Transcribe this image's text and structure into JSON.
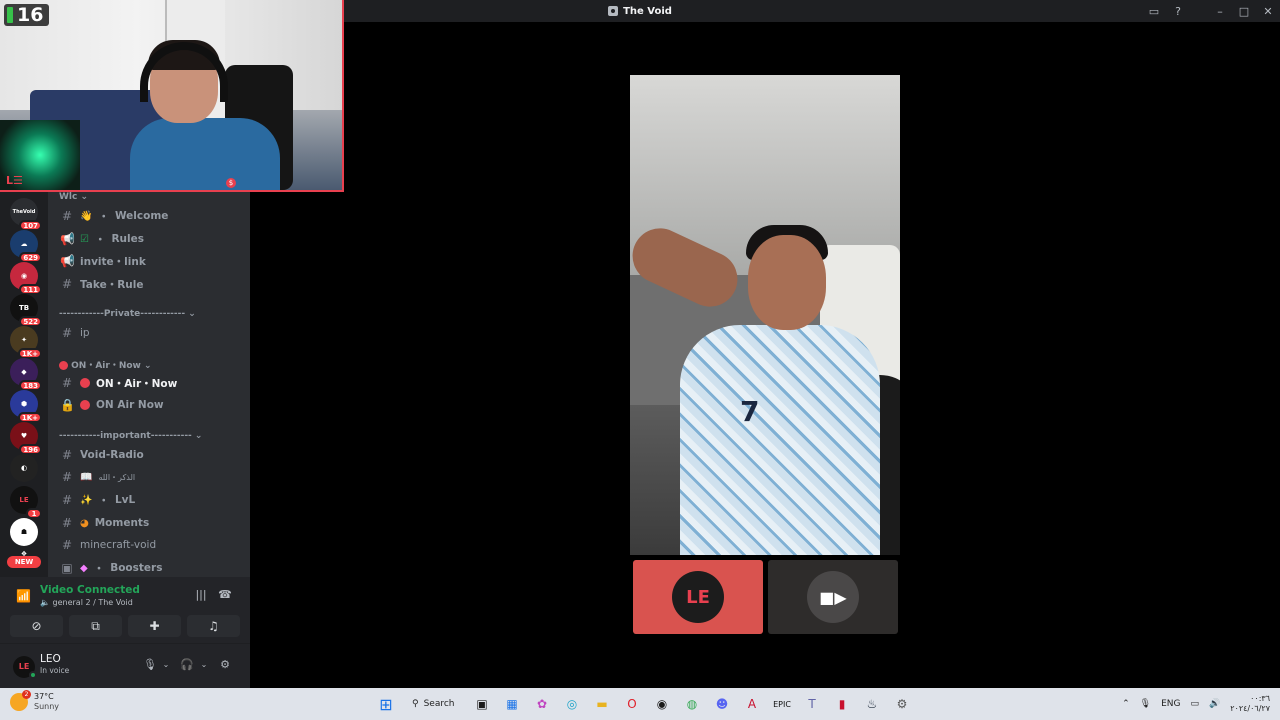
{
  "window": {
    "title": "The Void",
    "controls": [
      "inbox-icon",
      "help-icon",
      "minimize-icon",
      "maximize-icon",
      "close-icon"
    ]
  },
  "webcam": {
    "counter": "16",
    "accent": "#e8404f"
  },
  "rail": {
    "servers": [
      {
        "abbr": "TheVoid",
        "badge": "107"
      },
      {
        "abbr": "☁",
        "badge": "629"
      },
      {
        "abbr": "◉",
        "badge": "111"
      },
      {
        "abbr": "TB",
        "badge": "522"
      },
      {
        "abbr": "✦",
        "badge": "1K+"
      },
      {
        "abbr": "◆",
        "badge": "183"
      },
      {
        "abbr": "⬢",
        "badge": "1K+"
      },
      {
        "abbr": "♥",
        "badge": "196"
      },
      {
        "abbr": "◐",
        "badge": ""
      },
      {
        "abbr": "LE",
        "badge": "1"
      },
      {
        "abbr": "☗",
        "badge": ""
      },
      {
        "abbr": "❖",
        "badge": ""
      }
    ],
    "new_label": "NEW"
  },
  "channels": {
    "top_category": "Wlc",
    "welcome": "Welcome",
    "rules": "Rules",
    "invite": "invite・link",
    "take_rule": "Take・Rule",
    "private_category": "------------Private------------",
    "ip": "ip",
    "on_air_category": "ON・Air・Now",
    "on_air_now": "ON・Air・Now",
    "on_air_locked": "ON Air Now",
    "important_category": "-----------important-----------",
    "void_radio": "Void-Radio",
    "thikr": "الذكر・الله",
    "lvl": "LvL",
    "moments": "Moments",
    "minecraft": "minecraft-void",
    "boosters": "Boosters",
    "separator_dot": "・"
  },
  "voice": {
    "status": "Video Connected",
    "location": "general 2 / The Void"
  },
  "user": {
    "name": "LEO",
    "status": "In voice",
    "avatar_text": "LE"
  },
  "stage": {
    "main_jersey_number": "7",
    "my_tile_logo": "LE",
    "my_tile_color": "#d9534f",
    "cam_tile_color": "#2e2c2b"
  },
  "taskbar": {
    "weather_badge": "2",
    "temperature": "37°C",
    "condition": "Sunny",
    "search_label": "Search",
    "lang": "ENG",
    "clock_time": "٠٠:٣٦",
    "clock_date": "٢٠٢٤/٠٦/٢٧"
  }
}
